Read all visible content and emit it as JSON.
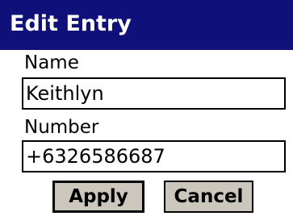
{
  "dialog": {
    "title": "Edit Entry"
  },
  "form": {
    "name_label": "Name",
    "name_value": "Keithlyn",
    "number_label": "Number",
    "number_value": "+6326586687"
  },
  "buttons": {
    "apply_label": "Apply",
    "cancel_label": "Cancel"
  },
  "colors": {
    "title_bar": "#10107a",
    "title_text": "#ffffff",
    "button_face": "#cbc7bd",
    "background": "#ffffff"
  }
}
